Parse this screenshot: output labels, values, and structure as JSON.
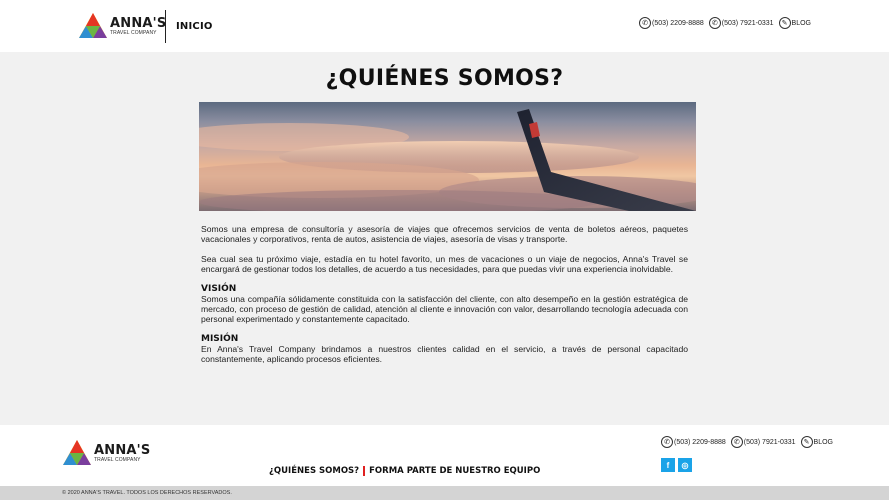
{
  "brand": {
    "name": "ANNA'S",
    "subtitle": "TRAVEL COMPANY"
  },
  "header": {
    "nav_label": "INICIO",
    "contacts": [
      {
        "icon": "phone-icon",
        "text": "(503) 2209-8888"
      },
      {
        "icon": "whatsapp-icon",
        "text": "(503) 7921-0331"
      },
      {
        "icon": "blog-icon",
        "text": "BLOG"
      }
    ]
  },
  "main": {
    "title": "¿QUIÉNES SOMOS?",
    "paragraphs": [
      "Somos una empresa de consultoría y asesoría de viajes que ofrecemos servicios de venta de boletos aéreos, paquetes vacacionales y corporativos, renta de autos, asistencia de viajes, asesoría de visas y transporte.",
      "Sea cual sea tu próximo viaje, estadía en tu hotel favorito, un mes de vacaciones o un viaje de negocios, Anna's Travel se encargará de gestionar todos los detalles, de acuerdo a tus necesidades, para que puedas vivir una experiencia inolvidable."
    ],
    "vision": {
      "heading": "VISIÓN",
      "text": "Somos una compañía sólidamente constituida con la satisfacción del cliente, con alto desempeño en la gestión estratégica de mercado, con proceso de gestión de calidad, atención al cliente e innovación con valor, desarrollando tecnología adecuada con personal experimentado y constantemente capacitado."
    },
    "mision": {
      "heading": "MISIÓN",
      "text": "En Anna's Travel Company brindamos a nuestros clientes calidad en el servicio, a través de personal capacitado constantemente, aplicando procesos eficientes."
    }
  },
  "footer": {
    "links": [
      "¿QUIÉNES SOMOS?",
      "FORMA PARTE DE NUESTRO EQUIPO"
    ],
    "contacts": [
      {
        "icon": "phone-icon",
        "text": "(503) 2209-8888"
      },
      {
        "icon": "whatsapp-icon",
        "text": "(503) 7921-0331"
      },
      {
        "icon": "blog-icon",
        "text": "BLOG"
      }
    ],
    "socials": [
      {
        "icon": "facebook-icon",
        "glyph": "f"
      },
      {
        "icon": "instagram-icon",
        "glyph": "◎"
      }
    ],
    "copyright": "© 2020 ANNA'S TRAVEL. TODOS LOS DERECHOS RESERVADOS."
  },
  "colors": {
    "accent_red": "#e02020",
    "social_blue": "#1aa3e8"
  }
}
